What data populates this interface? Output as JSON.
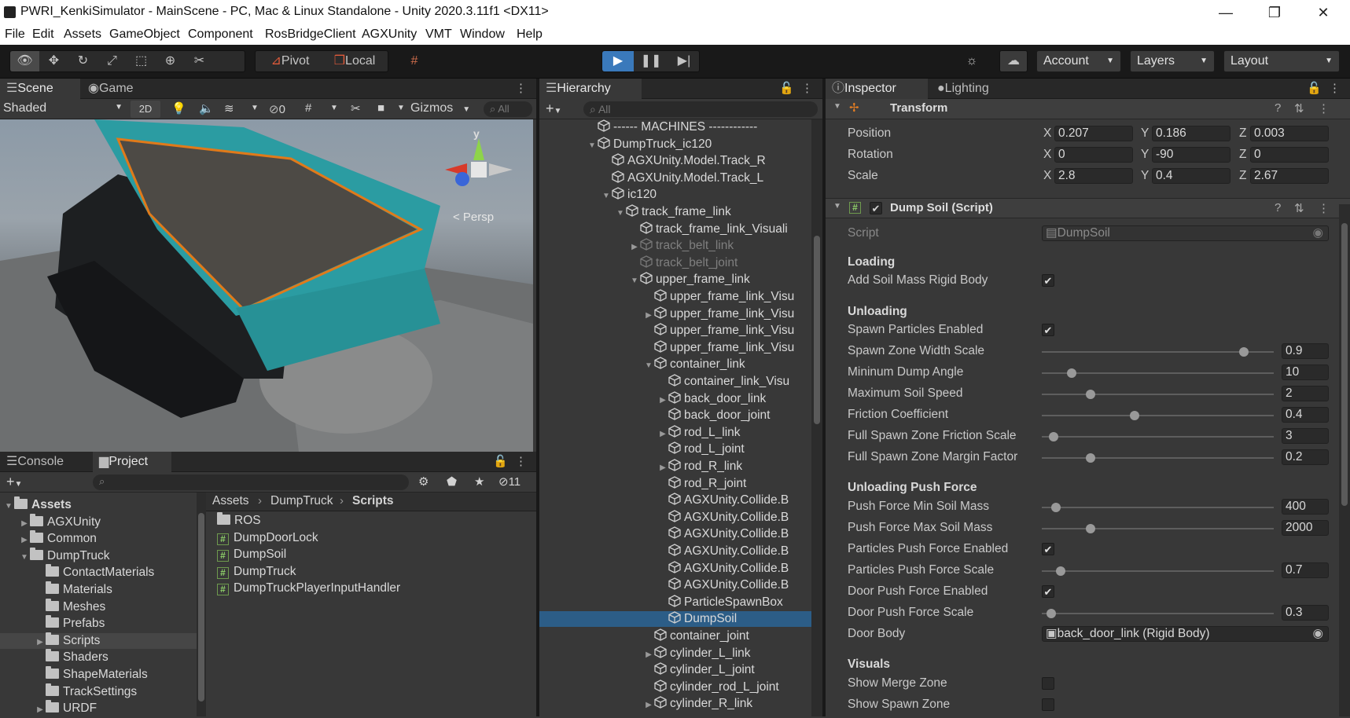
{
  "window": {
    "title": "PWRI_KenkiSimulator - MainScene - PC, Mac & Linux Standalone - Unity 2020.3.11f1 <DX11>",
    "minimize": "—",
    "maximize": "❐",
    "close": "✕"
  },
  "menu": [
    "File",
    "Edit",
    "Assets",
    "GameObject",
    "Component",
    "RosBridgeClient",
    "AGXUnity",
    "VMT",
    "Window",
    "Help"
  ],
  "toolbar": {
    "pivot": "Pivot",
    "local": "Local",
    "account": "Account",
    "layers": "Layers",
    "layout": "Layout"
  },
  "scene": {
    "tab_scene": "Scene",
    "tab_game": "Game",
    "shading": "Shaded",
    "mode_2d": "2D",
    "hidden_count": "0",
    "gizmos": "Gizmos",
    "search_placeholder": "All",
    "persp": "< Persp",
    "gizmo_y": "y"
  },
  "project": {
    "tab_console": "Console",
    "tab_project": "Project",
    "hidden_count": "11",
    "tree": [
      {
        "label": "Assets",
        "indent": 0,
        "fold": "▼"
      },
      {
        "label": "AGXUnity",
        "indent": 1,
        "fold": "▶"
      },
      {
        "label": "Common",
        "indent": 1,
        "fold": "▶"
      },
      {
        "label": "DumpTruck",
        "indent": 1,
        "fold": "▼"
      },
      {
        "label": "ContactMaterials",
        "indent": 2,
        "fold": ""
      },
      {
        "label": "Materials",
        "indent": 2,
        "fold": ""
      },
      {
        "label": "Meshes",
        "indent": 2,
        "fold": ""
      },
      {
        "label": "Prefabs",
        "indent": 2,
        "fold": ""
      },
      {
        "label": "Scripts",
        "indent": 2,
        "fold": "▶",
        "selected": true
      },
      {
        "label": "Shaders",
        "indent": 2,
        "fold": ""
      },
      {
        "label": "ShapeMaterials",
        "indent": 2,
        "fold": ""
      },
      {
        "label": "TrackSettings",
        "indent": 2,
        "fold": ""
      },
      {
        "label": "URDF",
        "indent": 2,
        "fold": "▶"
      }
    ],
    "breadcrumb": [
      "Assets",
      "DumpTruck",
      "Scripts"
    ],
    "files": [
      {
        "label": "ROS",
        "kind": "folder"
      },
      {
        "label": "DumpDoorLock",
        "kind": "script"
      },
      {
        "label": "DumpSoil",
        "kind": "script"
      },
      {
        "label": "DumpTruck",
        "kind": "script"
      },
      {
        "label": "DumpTruckPlayerInputHandler",
        "kind": "script"
      }
    ]
  },
  "hierarchy": {
    "tab": "Hierarchy",
    "search_placeholder": "All",
    "items": [
      {
        "label": "------ MACHINES ------------",
        "indent": 0,
        "fold": ""
      },
      {
        "label": "DumpTruck_ic120",
        "indent": 0,
        "fold": "▼"
      },
      {
        "label": "AGXUnity.Model.Track_R",
        "indent": 1,
        "fold": ""
      },
      {
        "label": "AGXUnity.Model.Track_L",
        "indent": 1,
        "fold": ""
      },
      {
        "label": "ic120",
        "indent": 1,
        "fold": "▼"
      },
      {
        "label": "track_frame_link",
        "indent": 2,
        "fold": "▼"
      },
      {
        "label": "track_frame_link_Visuali",
        "indent": 3,
        "fold": ""
      },
      {
        "label": "track_belt_link",
        "indent": 3,
        "fold": "▶",
        "dim": true
      },
      {
        "label": "track_belt_joint",
        "indent": 3,
        "fold": "",
        "dim": true
      },
      {
        "label": "upper_frame_link",
        "indent": 3,
        "fold": "▼"
      },
      {
        "label": "upper_frame_link_Visu",
        "indent": 4,
        "fold": ""
      },
      {
        "label": "upper_frame_link_Visu",
        "indent": 4,
        "fold": "▶"
      },
      {
        "label": "upper_frame_link_Visu",
        "indent": 4,
        "fold": ""
      },
      {
        "label": "upper_frame_link_Visu",
        "indent": 4,
        "fold": ""
      },
      {
        "label": "container_link",
        "indent": 4,
        "fold": "▼"
      },
      {
        "label": "container_link_Visu",
        "indent": 5,
        "fold": ""
      },
      {
        "label": "back_door_link",
        "indent": 5,
        "fold": "▶"
      },
      {
        "label": "back_door_joint",
        "indent": 5,
        "fold": ""
      },
      {
        "label": "rod_L_link",
        "indent": 5,
        "fold": "▶"
      },
      {
        "label": "rod_L_joint",
        "indent": 5,
        "fold": ""
      },
      {
        "label": "rod_R_link",
        "indent": 5,
        "fold": "▶"
      },
      {
        "label": "rod_R_joint",
        "indent": 5,
        "fold": ""
      },
      {
        "label": "AGXUnity.Collide.B",
        "indent": 5,
        "fold": ""
      },
      {
        "label": "AGXUnity.Collide.B",
        "indent": 5,
        "fold": ""
      },
      {
        "label": "AGXUnity.Collide.B",
        "indent": 5,
        "fold": ""
      },
      {
        "label": "AGXUnity.Collide.B",
        "indent": 5,
        "fold": ""
      },
      {
        "label": "AGXUnity.Collide.B",
        "indent": 5,
        "fold": ""
      },
      {
        "label": "AGXUnity.Collide.B",
        "indent": 5,
        "fold": ""
      },
      {
        "label": "ParticleSpawnBox",
        "indent": 5,
        "fold": ""
      },
      {
        "label": "DumpSoil",
        "indent": 5,
        "fold": "",
        "selected": true
      },
      {
        "label": "container_joint",
        "indent": 4,
        "fold": ""
      },
      {
        "label": "cylinder_L_link",
        "indent": 4,
        "fold": "▶"
      },
      {
        "label": "cylinder_L_joint",
        "indent": 4,
        "fold": ""
      },
      {
        "label": "cylinder_rod_L_joint",
        "indent": 4,
        "fold": ""
      },
      {
        "label": "cylinder_R_link",
        "indent": 4,
        "fold": "▶"
      }
    ]
  },
  "inspector": {
    "tab_inspector": "Inspector",
    "tab_lighting": "Lighting",
    "transform": {
      "title": "Transform",
      "position_label": "Position",
      "rotation_label": "Rotation",
      "scale_label": "Scale",
      "position": [
        "0.207",
        "0.186",
        "0.003"
      ],
      "rotation": [
        "0",
        "-90",
        "0"
      ],
      "scale": [
        "2.8",
        "0.4",
        "2.67"
      ]
    },
    "component": {
      "title": "Dump Soil (Script)",
      "script_label": "Script",
      "script_value": "DumpSoil"
    },
    "sections": {
      "loading": "Loading",
      "unloading": "Unloading",
      "push_force": "Unloading Push Force",
      "visuals": "Visuals"
    },
    "props": {
      "add_soil_mass": {
        "label": "Add Soil Mass Rigid Body",
        "checked": true
      },
      "spawn_particles": {
        "label": "Spawn Particles Enabled",
        "checked": true
      },
      "spawn_zone_width": {
        "label": "Spawn Zone Width Scale",
        "value": "0.9",
        "fill": 0.87
      },
      "min_dump_angle": {
        "label": "Mininum Dump Angle",
        "value": "10",
        "fill": 0.13
      },
      "max_soil_speed": {
        "label": "Maximum Soil Speed",
        "value": "2",
        "fill": 0.21
      },
      "friction": {
        "label": "Friction Coefficient",
        "value": "0.4",
        "fill": 0.4
      },
      "full_spawn_friction": {
        "label": "Full Spawn Zone Friction Scale",
        "value": "3",
        "fill": 0.05
      },
      "full_spawn_margin": {
        "label": "Full Spawn Zone Margin Factor",
        "value": "0.2",
        "fill": 0.21
      },
      "push_min_mass": {
        "label": "Push Force Min Soil Mass",
        "value": "400",
        "fill": 0.06
      },
      "push_max_mass": {
        "label": "Push Force Max Soil Mass",
        "value": "2000",
        "fill": 0.21
      },
      "particles_push_enabled": {
        "label": "Particles Push Force Enabled",
        "checked": true
      },
      "particles_push_scale": {
        "label": "Particles Push Force Scale",
        "value": "0.7",
        "fill": 0.08
      },
      "door_push_enabled": {
        "label": "Door Push Force Enabled",
        "checked": true
      },
      "door_push_scale": {
        "label": "Door Push Force Scale",
        "value": "0.3",
        "fill": 0.04
      },
      "door_body": {
        "label": "Door Body",
        "value": "back_door_link (Rigid Body)"
      },
      "show_merge": {
        "label": "Show Merge Zone",
        "checked": false
      },
      "show_spawn": {
        "label": "Show Spawn Zone",
        "checked": false
      }
    }
  }
}
